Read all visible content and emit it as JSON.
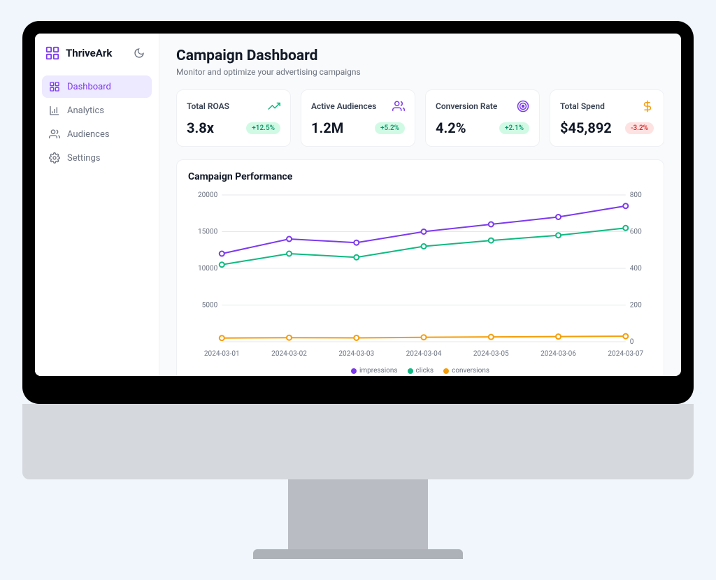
{
  "brand": "ThriveArk",
  "sidebar": {
    "items": [
      {
        "label": "Dashboard",
        "active": true
      },
      {
        "label": "Analytics",
        "active": false
      },
      {
        "label": "Audiences",
        "active": false
      },
      {
        "label": "Settings",
        "active": false
      }
    ]
  },
  "header": {
    "title": "Campaign Dashboard",
    "subtitle": "Monitor and optimize your advertising campaigns"
  },
  "kpis": [
    {
      "label": "Total ROAS",
      "value": "3.8x",
      "delta": "+12.5%",
      "trend": "up",
      "icon": "trend",
      "iconColor": "green"
    },
    {
      "label": "Active Audiences",
      "value": "1.2M",
      "delta": "+5.2%",
      "trend": "up",
      "icon": "users",
      "iconColor": "purple"
    },
    {
      "label": "Conversion Rate",
      "value": "4.2%",
      "delta": "+2.1%",
      "trend": "up",
      "icon": "target",
      "iconColor": "purple"
    },
    {
      "label": "Total Spend",
      "value": "$45,892",
      "delta": "-3.2%",
      "trend": "down",
      "icon": "dollar",
      "iconColor": "orange"
    }
  ],
  "chart_data": {
    "type": "line",
    "title": "Campaign Performance",
    "x": [
      "2024-03-01",
      "2024-03-02",
      "2024-03-03",
      "2024-03-04",
      "2024-03-05",
      "2024-03-06",
      "2024-03-07"
    ],
    "y_left_ticks": [
      5000,
      10000,
      15000,
      20000
    ],
    "y_right_ticks": [
      0,
      200,
      400,
      600,
      800
    ],
    "y_left_lim": [
      0,
      20000
    ],
    "y_right_lim": [
      0,
      800
    ],
    "series": [
      {
        "name": "impressions",
        "axis": "left",
        "color": "#7c3aed",
        "values": [
          12000,
          14000,
          13500,
          15000,
          16000,
          17000,
          18500
        ]
      },
      {
        "name": "clicks",
        "axis": "left",
        "color": "#10b981",
        "values": [
          10500,
          12000,
          11500,
          13000,
          13800,
          14500,
          15500
        ]
      },
      {
        "name": "conversions",
        "axis": "right",
        "color": "#f59e0b",
        "values": [
          20,
          22,
          21,
          24,
          26,
          28,
          30
        ]
      }
    ]
  }
}
